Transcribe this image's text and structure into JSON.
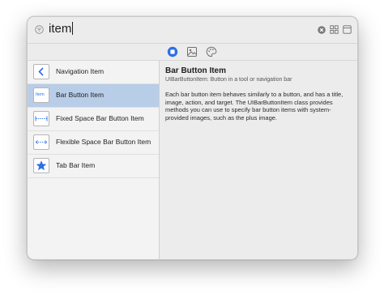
{
  "search": {
    "query": "item"
  },
  "library_items": [
    {
      "label": "Navigation Item",
      "thumb_text": ""
    },
    {
      "label": "Bar Button Item",
      "thumb_text": "Item"
    },
    {
      "label": "Fixed Space Bar Button Item",
      "thumb_text": ""
    },
    {
      "label": "Flexible Space Bar Button Item",
      "thumb_text": ""
    },
    {
      "label": "Tab Bar Item",
      "thumb_text": ""
    }
  ],
  "selected_index": 1,
  "detail": {
    "title": "Bar Button Item",
    "subtitle": "UIBarButtonItem: Button in a tool or navigation bar",
    "description": "Each bar button item behaves similarly to a button, and has a title, image, action, and target. The UIBarButtonItem class provides methods you can use to specify bar button items with system-provided images, such as the plus image."
  },
  "icons": {
    "filter": "filter-icon",
    "clear": "clear-search-icon",
    "grid": "grid-view-icon",
    "panel": "panel-toggle-icon",
    "tab_objects": "objects-library-icon",
    "tab_media": "media-library-icon",
    "tab_colors": "color-library-icon"
  },
  "colors": {
    "accent": "#2e6fe6",
    "selection": "#b8cde8"
  }
}
